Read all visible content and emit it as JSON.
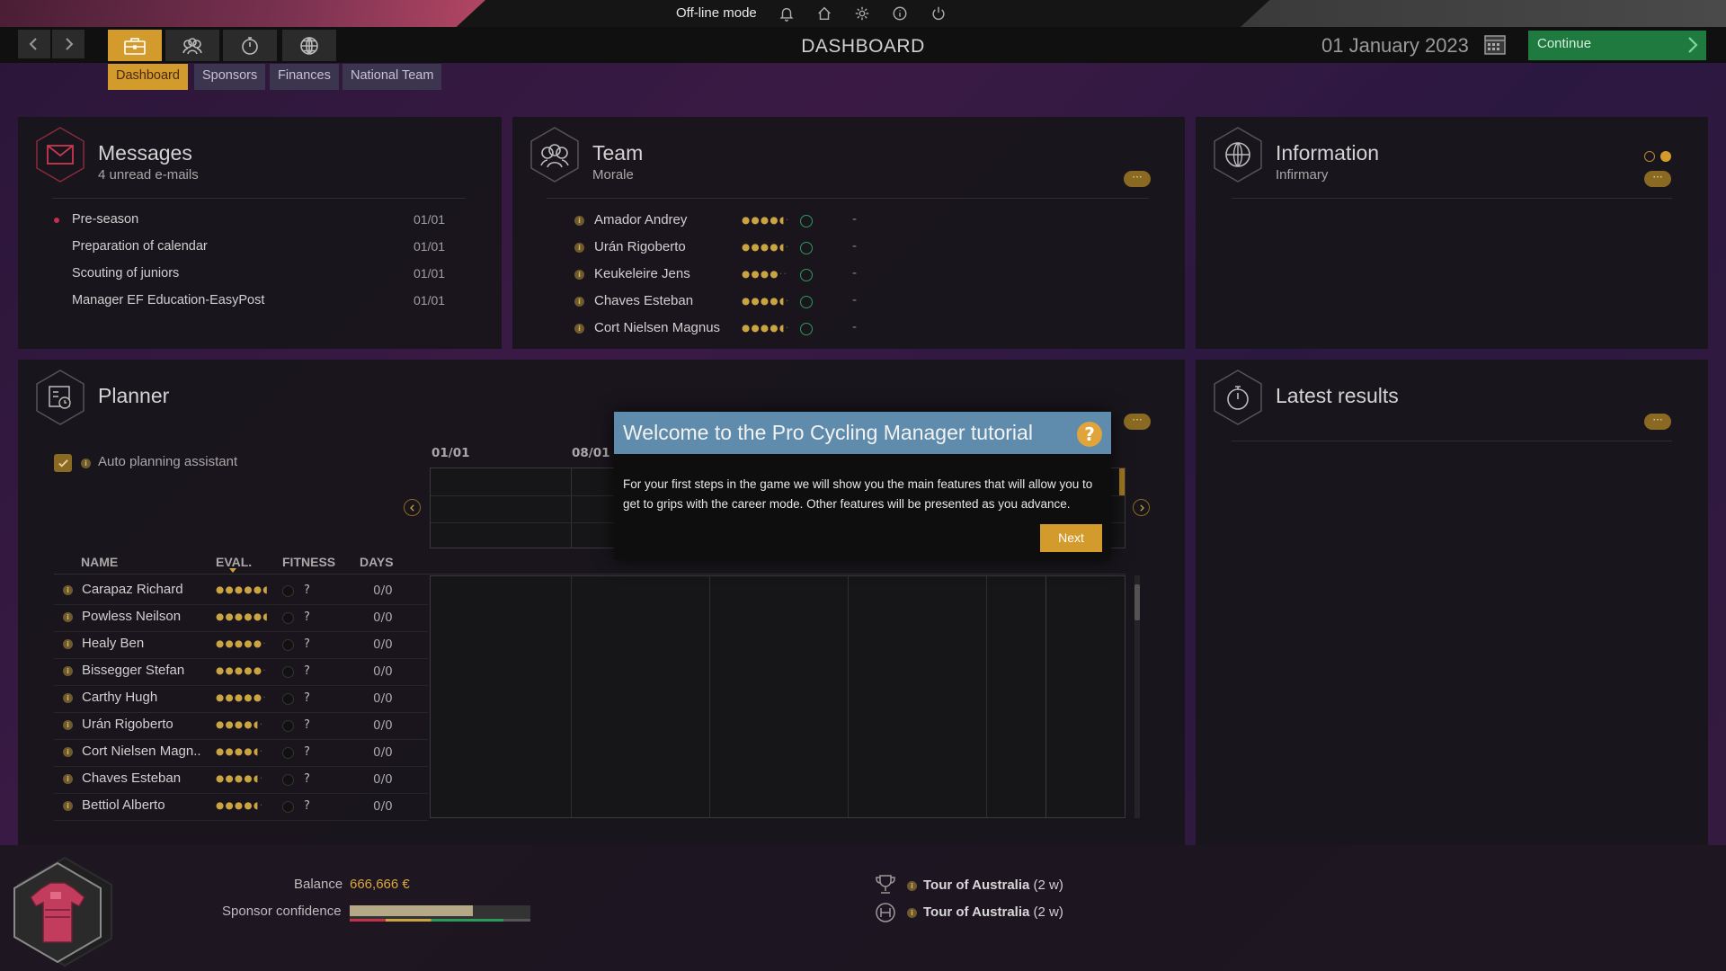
{
  "topbar": {
    "mode_label": "Off-line mode",
    "icons": [
      "bell-icon",
      "home-icon",
      "gear-icon",
      "info-icon",
      "power-icon"
    ]
  },
  "header": {
    "title": "DASHBOARD",
    "date": "01 January 2023",
    "continue_label": "Continue"
  },
  "subtabs": [
    "Dashboard",
    "Sponsors",
    "Finances",
    "National Team"
  ],
  "messages": {
    "title": "Messages",
    "subtitle": "4 unread e-mails",
    "items": [
      {
        "subject": "Pre-season",
        "date": "01/01",
        "unread": true
      },
      {
        "subject": "Preparation of calendar",
        "date": "01/01",
        "unread": false
      },
      {
        "subject": "Scouting of juniors",
        "date": "01/01",
        "unread": false
      },
      {
        "subject": "Manager EF Education-EasyPost",
        "date": "01/01",
        "unread": false
      }
    ]
  },
  "team": {
    "title": "Team",
    "subtitle": "Morale",
    "riders": [
      {
        "name": "Amador Andrey",
        "stars": 4.5,
        "status": "-"
      },
      {
        "name": "Urán Rigoberto",
        "stars": 4.5,
        "status": "-"
      },
      {
        "name": "Keukeleire Jens",
        "stars": 4,
        "status": "-"
      },
      {
        "name": "Chaves Esteban",
        "stars": 4.5,
        "status": "-"
      },
      {
        "name": "Cort Nielsen Magnus",
        "stars": 4.5,
        "status": "-"
      }
    ]
  },
  "information": {
    "title": "Information",
    "subtitle": "Infirmary"
  },
  "planner": {
    "title": "Planner",
    "auto_label": "Auto planning assistant",
    "dates": [
      "01/01",
      "08/01"
    ],
    "columns": [
      "NAME",
      "EVAL.",
      "FITNESS",
      "DAYS"
    ],
    "riders": [
      {
        "name": "Carapaz Richard",
        "stars": 5.5,
        "fitness": "?",
        "days": "0/0"
      },
      {
        "name": "Powless Neilson",
        "stars": 5.5,
        "fitness": "?",
        "days": "0/0"
      },
      {
        "name": "Healy Ben",
        "stars": 5,
        "fitness": "?",
        "days": "0/0"
      },
      {
        "name": "Bissegger Stefan",
        "stars": 5,
        "fitness": "?",
        "days": "0/0"
      },
      {
        "name": "Carthy Hugh",
        "stars": 5,
        "fitness": "?",
        "days": "0/0"
      },
      {
        "name": "Urán Rigoberto",
        "stars": 4.5,
        "fitness": "?",
        "days": "0/0"
      },
      {
        "name": "Cort Nielsen Magn..",
        "stars": 4.5,
        "fitness": "?",
        "days": "0/0"
      },
      {
        "name": "Chaves Esteban",
        "stars": 4.5,
        "fitness": "?",
        "days": "0/0"
      },
      {
        "name": "Bettiol Alberto",
        "stars": 4.5,
        "fitness": "?",
        "days": "0/0"
      }
    ]
  },
  "latest_results": {
    "title": "Latest results"
  },
  "modal": {
    "title": "Welcome to the Pro Cycling Manager tutorial",
    "body": "For your first steps in the game we will show you the main features that will allow you to get to grips with the career mode. Other features will be presented as you advance.",
    "next_label": "Next"
  },
  "bottom": {
    "balance_label": "Balance",
    "balance_value": "666,666 €",
    "sponsor_label": "Sponsor confidence",
    "sponsor_confidence": 0.68,
    "races": [
      {
        "name": "Tour of Australia",
        "when": "(2 w)",
        "icon": "trophy-icon"
      },
      {
        "name": "Tour of Australia",
        "when": "(2 w)",
        "icon": "stage-icon"
      }
    ]
  },
  "colors": {
    "accent": "#d39a2c",
    "continue": "#1e7a3e",
    "modal_header": "#5f8cac"
  }
}
